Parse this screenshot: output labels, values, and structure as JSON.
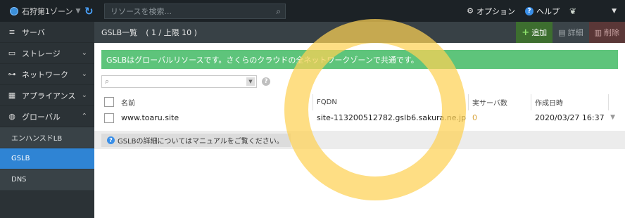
{
  "topbar": {
    "zone_label": "石狩第1ゾーン",
    "search_placeholder": "リソースを検索...",
    "option_label": "オプション",
    "help_label": "ヘルプ"
  },
  "sidebar": {
    "items": [
      {
        "label": "サーバ",
        "icon": "server-icon"
      },
      {
        "label": "ストレージ",
        "icon": "storage-icon"
      },
      {
        "label": "ネットワーク",
        "icon": "network-icon"
      },
      {
        "label": "アプライアンス",
        "icon": "appliance-icon"
      },
      {
        "label": "グローバル",
        "icon": "globe-icon"
      }
    ],
    "subitems": [
      {
        "label": "エンハンスドLB",
        "active": false
      },
      {
        "label": "GSLB",
        "active": true
      },
      {
        "label": "DNS",
        "active": false
      }
    ]
  },
  "main": {
    "title": "GSLB一覧",
    "count": "( 1 / 上限 10 )",
    "actions": {
      "add": "追加",
      "detail": "詳細",
      "delete": "削除"
    },
    "notice": "GSLBはグローバルリソースです。さくらのクラウドの全ネットワークゾーンで共通です。",
    "table": {
      "headers": {
        "name": "名前",
        "fqdn": "FQDN",
        "servers": "実サーバ数",
        "created": "作成日時"
      },
      "rows": [
        {
          "name": "www.toaru.site",
          "fqdn": "site-113200512782.gslb6.sakura.ne.jp",
          "servers": "0",
          "created": "2020/03/27 16:37"
        }
      ]
    },
    "manual_text": "GSLBの詳細についてはマニュアルをご覧ください。"
  },
  "colors": {
    "notice_bg": "#5ec47b",
    "active_nav": "#2f84d4",
    "highlight_ring": "#fdd154"
  }
}
